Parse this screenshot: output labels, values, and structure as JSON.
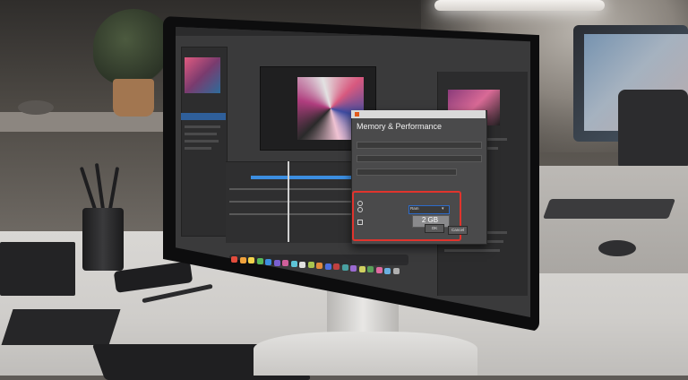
{
  "scene": {
    "description_colors": {
      "accent_highlight": "#e0342d",
      "app_accent": "#3c8ee0",
      "dialog_icon": "#e25a1c"
    }
  },
  "dialog": {
    "title": "Memory & Performance",
    "ram_dropdown_value": "Ram",
    "ram_amount": "2 GB",
    "ok_label": "OK",
    "cancel_label": "Cancel"
  },
  "monitor": {
    "dock_icon_colors": [
      "#e24c3c",
      "#f0a23c",
      "#f3d34c",
      "#58b85a",
      "#3c8ee0",
      "#7a5fd0",
      "#d05f9a",
      "#5ec4d6",
      "#e0e0e0",
      "#a8c54f",
      "#e28a3c",
      "#4c6fe0",
      "#c04040",
      "#48a0a0",
      "#9a6ad0",
      "#d0d060",
      "#5aa05a",
      "#e06aa0",
      "#6ab0e0",
      "#b0b0b0"
    ]
  }
}
